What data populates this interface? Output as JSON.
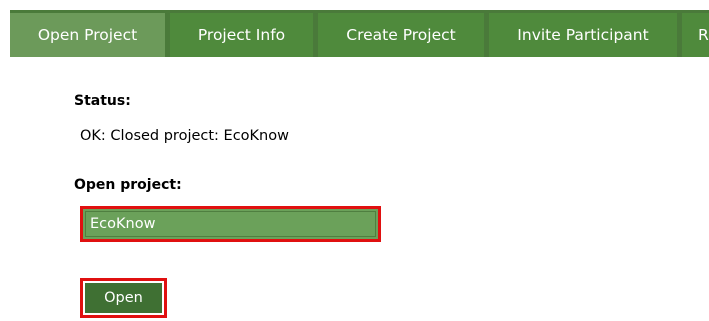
{
  "tabs": [
    {
      "label": "Open Project",
      "active": true
    },
    {
      "label": "Project Info",
      "active": false
    },
    {
      "label": "Create Project",
      "active": false
    },
    {
      "label": "Invite Participant",
      "active": false
    },
    {
      "label": "R",
      "active": false
    }
  ],
  "status": {
    "label": "Status:",
    "text": "OK: Closed project: EcoKnow"
  },
  "open_project": {
    "label": "Open project:",
    "selected": "EcoKnow",
    "button_label": "Open"
  },
  "colors": {
    "tab_bar": "#4a7a3a",
    "tab": "#4f8a3c",
    "tab_active": "#6c9a5a",
    "select_bg": "#6ba15a",
    "button_bg": "#3f7033",
    "highlight": "#e01010"
  }
}
